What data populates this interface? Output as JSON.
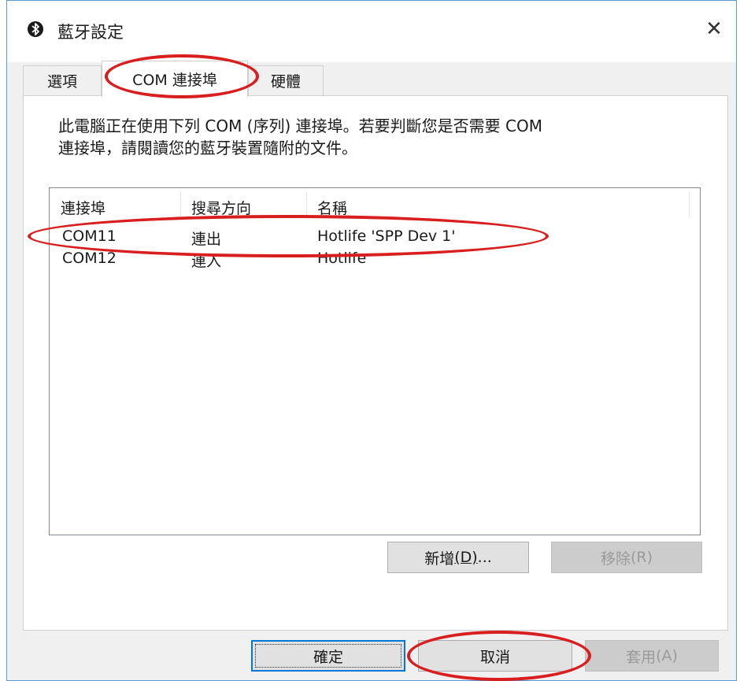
{
  "window": {
    "title": "藍牙設定",
    "close_symbol": "✕"
  },
  "tabs": [
    {
      "label": "選項"
    },
    {
      "label": "COM 連接埠"
    },
    {
      "label": "硬體"
    }
  ],
  "description": {
    "line1": "此電腦正在使用下列 COM (序列) 連接埠。若要判斷您是否需要 COM",
    "line2": "連接埠，請閱讀您的藍牙裝置隨附的文件。"
  },
  "ports_table": {
    "columns": [
      "連接埠",
      "搜尋方向",
      "名稱"
    ],
    "rows": [
      {
        "port": "COM11",
        "direction": "連出",
        "name": "Hotlife 'SPP Dev 1'"
      },
      {
        "port": "COM12",
        "direction": "連入",
        "name": "Hotlife"
      }
    ]
  },
  "panel_buttons": {
    "add": {
      "label": "新增",
      "mnemonic": "(D)",
      "suffix": "..."
    },
    "remove": {
      "label": "移除",
      "mnemonic": "(R)"
    }
  },
  "dialog_buttons": {
    "ok": {
      "label": "確定"
    },
    "cancel": {
      "label": "取消"
    },
    "apply": {
      "label": "套用",
      "mnemonic": "(A)"
    }
  },
  "annotation_color": "#d81e1e"
}
